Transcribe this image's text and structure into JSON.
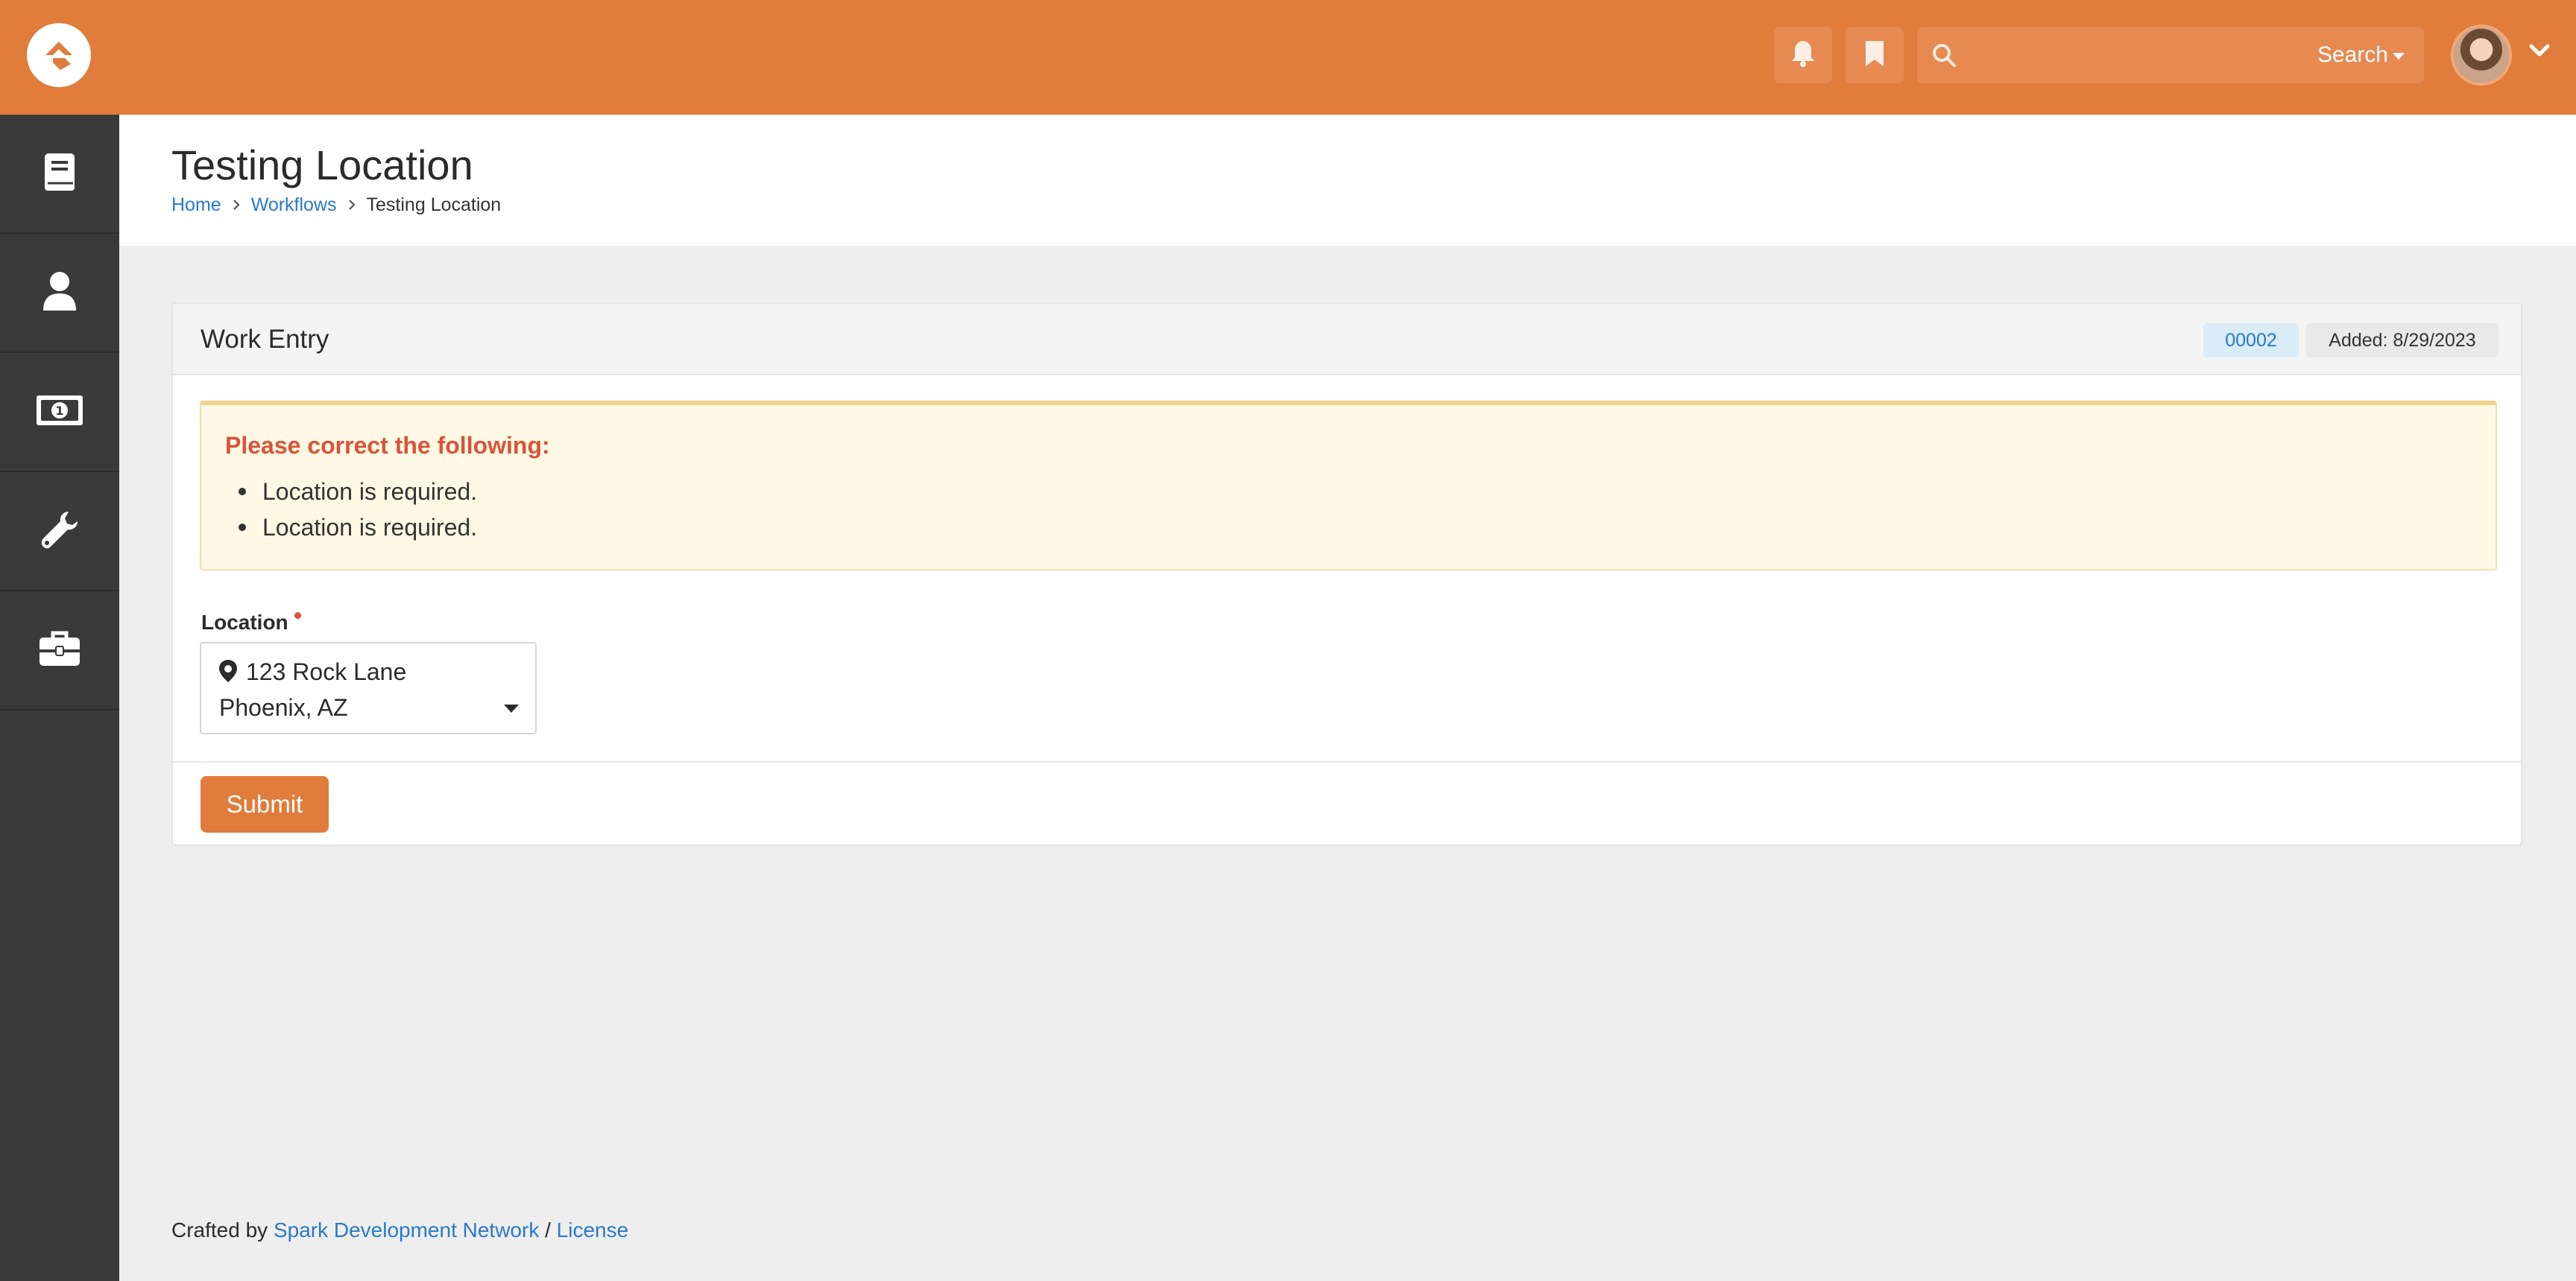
{
  "header": {
    "search_label": "Search",
    "icons": [
      "logo-icon",
      "bell-icon",
      "bookmark-icon",
      "search-icon",
      "avatar",
      "chevron-down-icon"
    ]
  },
  "sidebar": {
    "items": [
      {
        "icon": "book-icon"
      },
      {
        "icon": "person-icon"
      },
      {
        "icon": "money-icon"
      },
      {
        "icon": "wrench-icon"
      },
      {
        "icon": "briefcase-icon"
      }
    ]
  },
  "page": {
    "title": "Testing Location",
    "breadcrumb": [
      "Home",
      "Workflows",
      "Testing Location"
    ]
  },
  "panel": {
    "title": "Work Entry",
    "id_label": "00002",
    "added_label": "Added: 8/29/2023",
    "alert": {
      "title": "Please correct the following:",
      "items": [
        "Location is required.",
        "Location is required."
      ]
    },
    "location_field": {
      "label": "Location",
      "value_line1": "123 Rock Lane",
      "value_line2": "Phoenix, AZ"
    },
    "submit_label": "Submit"
  },
  "footer": {
    "prefix": "Crafted by",
    "org_link": "Spark Development Network",
    "separator": "/",
    "license_link": "License"
  },
  "colors": {
    "brand": "#e07c3c",
    "sidebar": "#3a3a3a",
    "link": "#2a79c9",
    "alert_title": "#d9533a",
    "alert_bg": "#fef8e4"
  }
}
